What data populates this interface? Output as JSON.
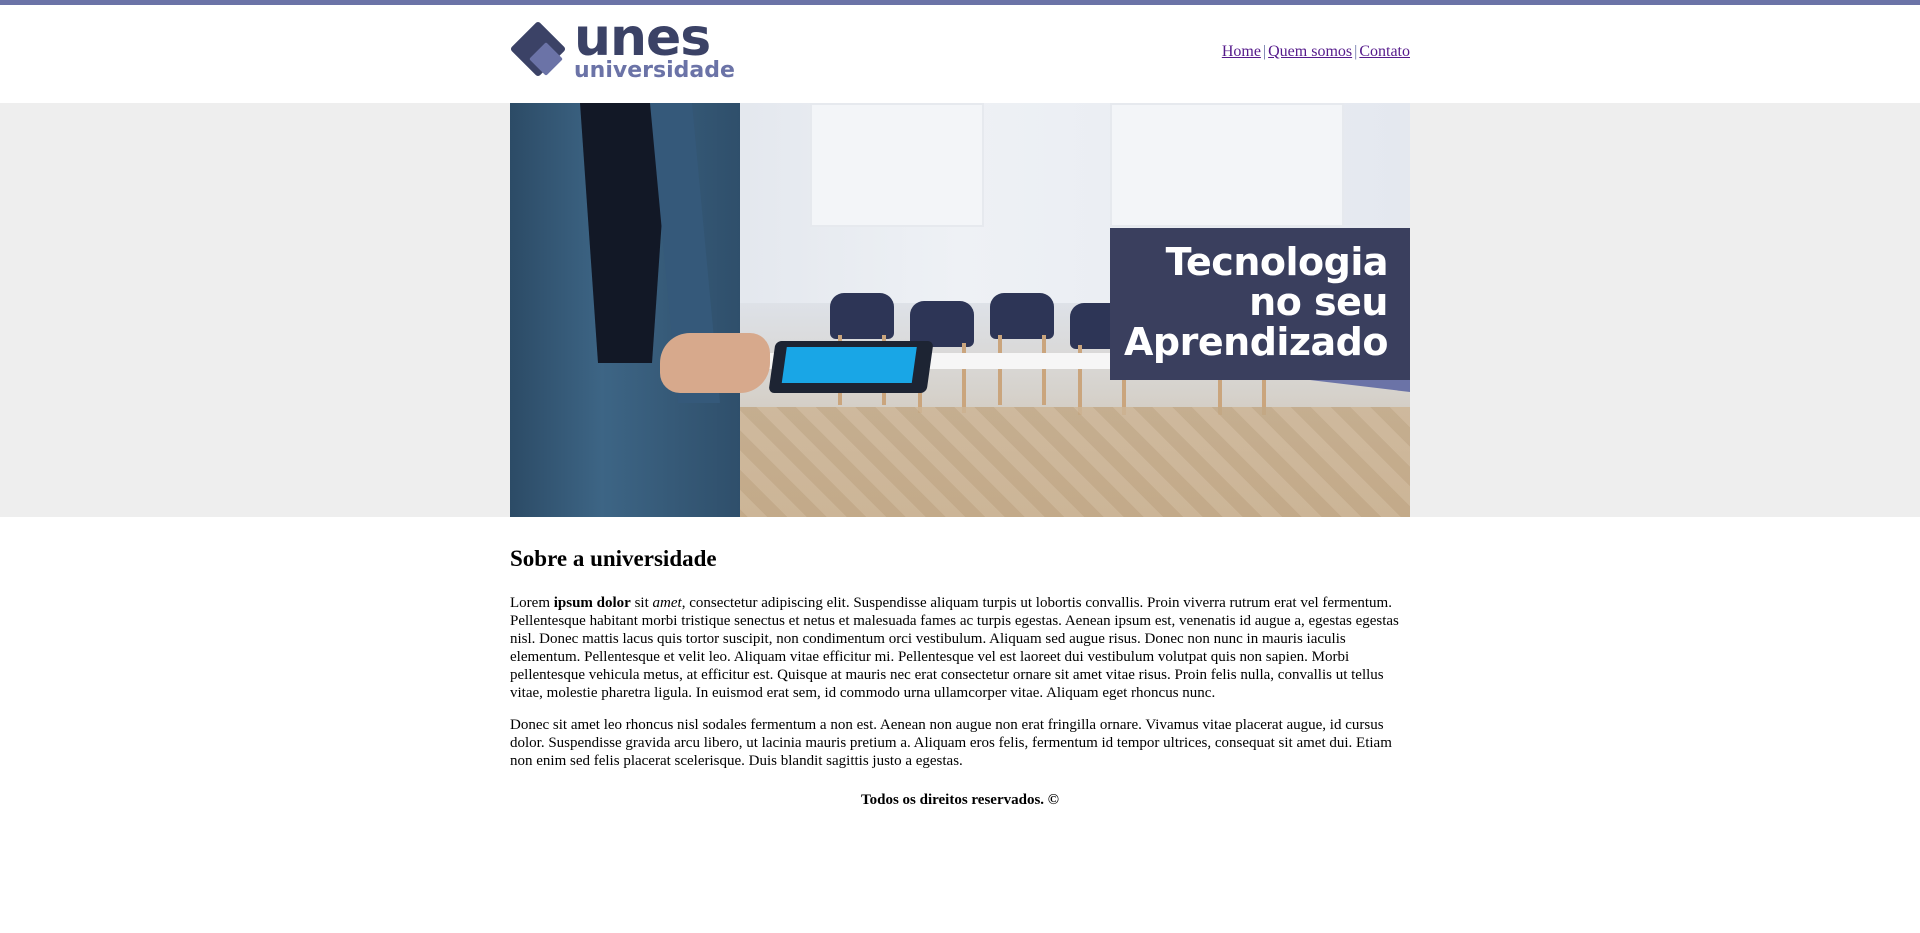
{
  "colors": {
    "accent": "#6b73a7",
    "brand_dark": "#3b4266",
    "caption_bg": "#3a3f5e",
    "hero_bg": "#eeeeee"
  },
  "logo": {
    "main": "unes",
    "sub": "universidade",
    "icon": "diamond-logo-icon"
  },
  "nav": {
    "items": [
      {
        "label": "Home"
      },
      {
        "label": "Quem somos"
      },
      {
        "label": "Contato"
      }
    ],
    "separator": "|"
  },
  "hero": {
    "caption_lines": [
      "Tecnologia",
      "no seu",
      "Aprendizado"
    ],
    "image": "man-holding-tablet-in-meeting-room"
  },
  "content": {
    "heading": "Sobre a universidade",
    "p1": {
      "t1": "Lorem ",
      "bold": "ipsum dolor",
      "t2": " sit ",
      "italic": "amet",
      "t3": ", consectetur adipiscing elit. Suspendisse aliquam turpis ut lobortis convallis. Proin viverra rutrum erat vel fermentum. Pellentesque habitant morbi tristique senectus et netus et malesuada fames ac turpis egestas. Aenean ipsum est, venenatis id augue a, egestas egestas nisl. Donec mattis lacus quis tortor suscipit, non condimentum orci vestibulum. Aliquam sed augue risus. Donec non nunc in mauris iaculis elementum. Pellentesque et velit leo. Aliquam vitae efficitur mi. Pellentesque vel est laoreet dui vestibulum volutpat quis non sapien. Morbi pellentesque vehicula metus, at efficitur est. Quisque at mauris nec erat consectetur ornare sit amet vitae risus. Proin felis nulla, convallis ut tellus vitae, molestie pharetra ligula. In euismod erat sem, id commodo urna ullamcorper vitae. Aliquam eget rhoncus nunc."
    },
    "p2": "Donec sit amet leo rhoncus nisl sodales fermentum a non est. Aenean non augue non erat fringilla ornare. Vivamus vitae placerat augue, id cursus dolor. Suspendisse gravida arcu libero, ut lacinia mauris pretium a. Aliquam eros felis, fermentum id tempor ultrices, consequat sit amet dui. Etiam non enim sed felis placerat scelerisque. Duis blandit sagittis justo a egestas."
  },
  "footer": {
    "text": "Todos os direitos reservados. ©"
  }
}
